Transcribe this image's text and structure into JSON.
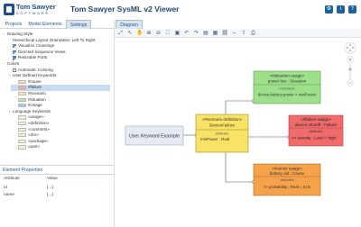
{
  "app": {
    "title": "Tom Sawyer SysML v2 Viewer",
    "logo_line1": "Tom Sawyer",
    "logo_line2": "SOFTWARE"
  },
  "left_tabs": [
    "Projects",
    "Model Elements",
    "Settings"
  ],
  "active_left_tab": "Settings",
  "settings_tree": [
    {
      "label": "Drawing Style",
      "level": 0,
      "toggle": "minus"
    },
    {
      "label": "Hierarchical Layout Orientation: Left To Right",
      "level": 1
    },
    {
      "label": "Visualize Crossings",
      "level": 1,
      "checkbox": true
    },
    {
      "label": "Directed Sequence Views",
      "level": 1,
      "checkbox": true
    },
    {
      "label": "Resizable Ports",
      "level": 1,
      "checkbox": true
    },
    {
      "label": "Colors",
      "level": 0,
      "toggle": "minus"
    },
    {
      "label": "Automatic Coloring",
      "level": 1,
      "checkbox": false
    },
    {
      "label": "User Defined Keywords",
      "level": 1,
      "toggle": "minus"
    },
    {
      "label": "#cause",
      "level": 2,
      "swatch": "#f7d9b0"
    },
    {
      "label": "#failure",
      "level": 2,
      "swatch": "#f2a7a7",
      "selected": true
    },
    {
      "label": "#scenario",
      "level": 2,
      "swatch": "#f7e6a6"
    },
    {
      "label": "#situation",
      "level": 2,
      "swatch": "#b9e3a8"
    },
    {
      "label": "#Usage",
      "level": 2,
      "swatch": "#a9c6ea"
    },
    {
      "label": "Language Keywords",
      "level": 1,
      "toggle": "plus"
    },
    {
      "label": "«usage»",
      "level": 2,
      "swatch": "#f5f0d0"
    },
    {
      "label": "«definition»",
      "level": 2,
      "swatch": "#f5f0d0"
    },
    {
      "label": "«comment»",
      "level": 2,
      "swatch": "#f5f0d0"
    },
    {
      "label": "«doc»",
      "level": 2,
      "swatch": "#f5f0d0"
    },
    {
      "label": "«package»",
      "level": 2,
      "swatch": "#f5f0d0"
    },
    {
      "label": "«part»",
      "level": 2,
      "swatch": "#f5f0d0"
    }
  ],
  "properties": {
    "title": "Element Properties",
    "columns": [
      "Attribute",
      "Value"
    ],
    "rows": [
      {
        "attribute": "id",
        "value": "[...]"
      },
      {
        "attribute": "name",
        "value": "[...]"
      }
    ]
  },
  "diagram": {
    "tab_label": "Diagram",
    "toolbar_icons": [
      "expand-icon",
      "select-arrow-icon",
      "pan-hand-icon",
      "zoom-in-icon",
      "zoom-out-icon",
      "zoom-fit-icon",
      "zoom-box-icon",
      "undo-icon",
      "redo-icon",
      "layout-icon",
      "grid-icon",
      "link-icon",
      "arrange-icon",
      "export-icon",
      "print-icon"
    ],
    "nodes": {
      "usage": {
        "label": "User Keyword Example"
      },
      "scenario": {
        "stereotype": "«#scenario definition»",
        "name": "DeviceFailure",
        "section": "attributes",
        "attribute": "minPower : Real"
      },
      "situation": {
        "stereotype": "«#situation usage»",
        "name": "power low : Situation",
        "section": "constraints",
        "constraint": "device.battery.power < minPower"
      },
      "failure": {
        "stereotype": "«#failure usage»",
        "name": "device shutoff : Failure",
        "section": "attributes",
        "attribute": ">> severity : Level = high"
      },
      "cause": {
        "stereotype": "«#cause usage»",
        "name": "battery old : Cause",
        "section": "attributes",
        "attribute": ">> probability : Real = 0.01"
      }
    }
  },
  "colors": {
    "situation": "#9ee08a",
    "failure": "#f26b6b",
    "cause": "#f5a24b",
    "scenario": "#f9e264",
    "usage": "#e6ebf3",
    "brand": "#1f4e8c"
  }
}
